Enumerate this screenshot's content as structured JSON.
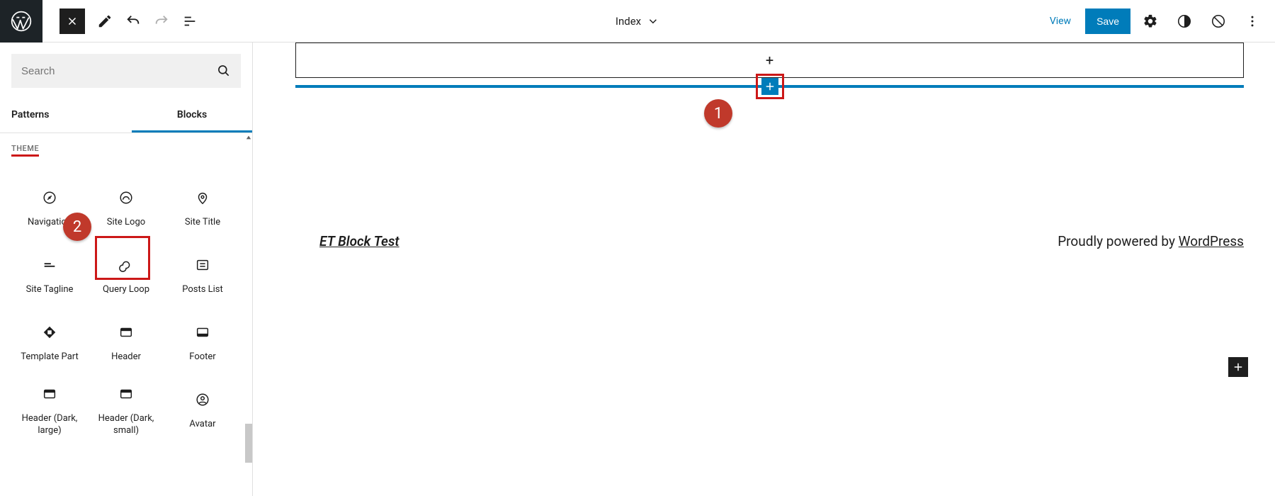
{
  "topbar": {
    "template_name": "Index",
    "view": "View",
    "save": "Save"
  },
  "inserter": {
    "search_placeholder": "Search",
    "tabs": {
      "patterns": "Patterns",
      "blocks": "Blocks"
    },
    "section": "THEME",
    "blocks": [
      {
        "name": "Navigation",
        "icon": "compass"
      },
      {
        "name": "Site Logo",
        "icon": "sitelogo"
      },
      {
        "name": "Site Title",
        "icon": "pin"
      },
      {
        "name": "Site Tagline",
        "icon": "tagline"
      },
      {
        "name": "Query Loop",
        "icon": "loop"
      },
      {
        "name": "Posts List",
        "icon": "postslist"
      },
      {
        "name": "Template Part",
        "icon": "tpart"
      },
      {
        "name": "Header",
        "icon": "header"
      },
      {
        "name": "Footer",
        "icon": "footer"
      },
      {
        "name": "Header (Dark, large)",
        "icon": "header"
      },
      {
        "name": "Header (Dark, small)",
        "icon": "header"
      },
      {
        "name": "Avatar",
        "icon": "avatar"
      }
    ]
  },
  "canvas": {
    "footer_site": "ET Block Test",
    "footer_credit_prefix": "Proudly powered by ",
    "footer_credit_link": "WordPress"
  },
  "annotations": {
    "badge1": "1",
    "badge2": "2"
  }
}
